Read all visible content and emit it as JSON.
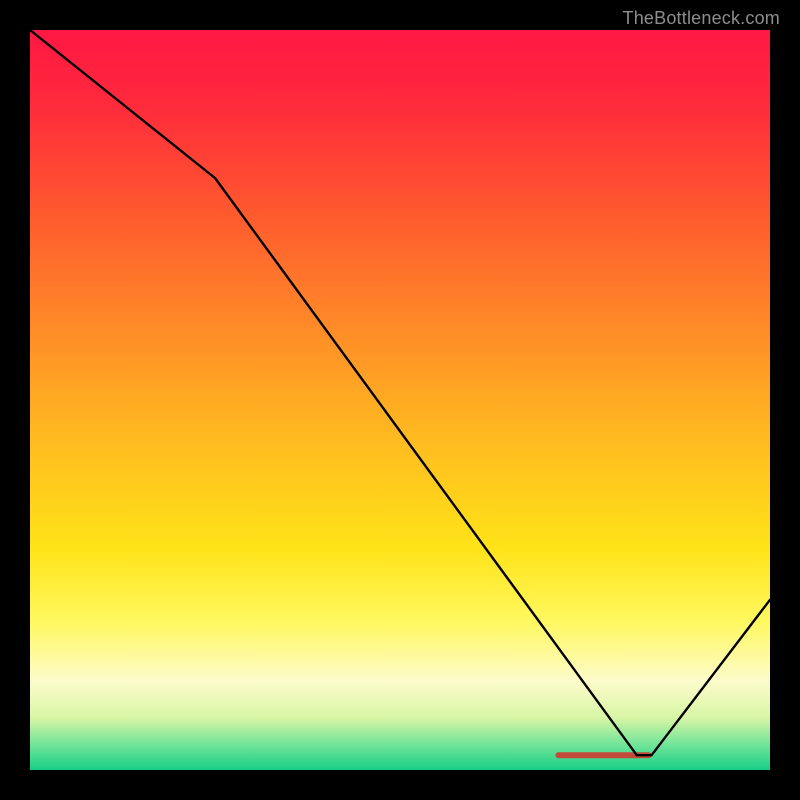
{
  "attribution": "TheBottleneck.com",
  "chart_data": {
    "type": "line",
    "title": "",
    "xlabel": "",
    "ylabel": "",
    "xlim": [
      0,
      100
    ],
    "ylim": [
      0,
      100
    ],
    "grid": false,
    "gradient_stops": [
      {
        "offset": 0.0,
        "color": "#ff1744"
      },
      {
        "offset": 0.1,
        "color": "#ff2a3c"
      },
      {
        "offset": 0.25,
        "color": "#ff5a2e"
      },
      {
        "offset": 0.4,
        "color": "#ff8a28"
      },
      {
        "offset": 0.55,
        "color": "#ffba20"
      },
      {
        "offset": 0.7,
        "color": "#ffe318"
      },
      {
        "offset": 0.8,
        "color": "#fff860"
      },
      {
        "offset": 0.88,
        "color": "#fdfccb"
      },
      {
        "offset": 0.93,
        "color": "#d7f5a4"
      },
      {
        "offset": 0.965,
        "color": "#73e59a"
      },
      {
        "offset": 1.0,
        "color": "#17cf87"
      }
    ],
    "x": [
      0,
      25,
      82,
      84,
      100
    ],
    "values": [
      100,
      80,
      2,
      2,
      23
    ],
    "marker_band": {
      "x_start": 71,
      "x_end": 84,
      "y": 2,
      "color": "#c24a3a"
    }
  }
}
